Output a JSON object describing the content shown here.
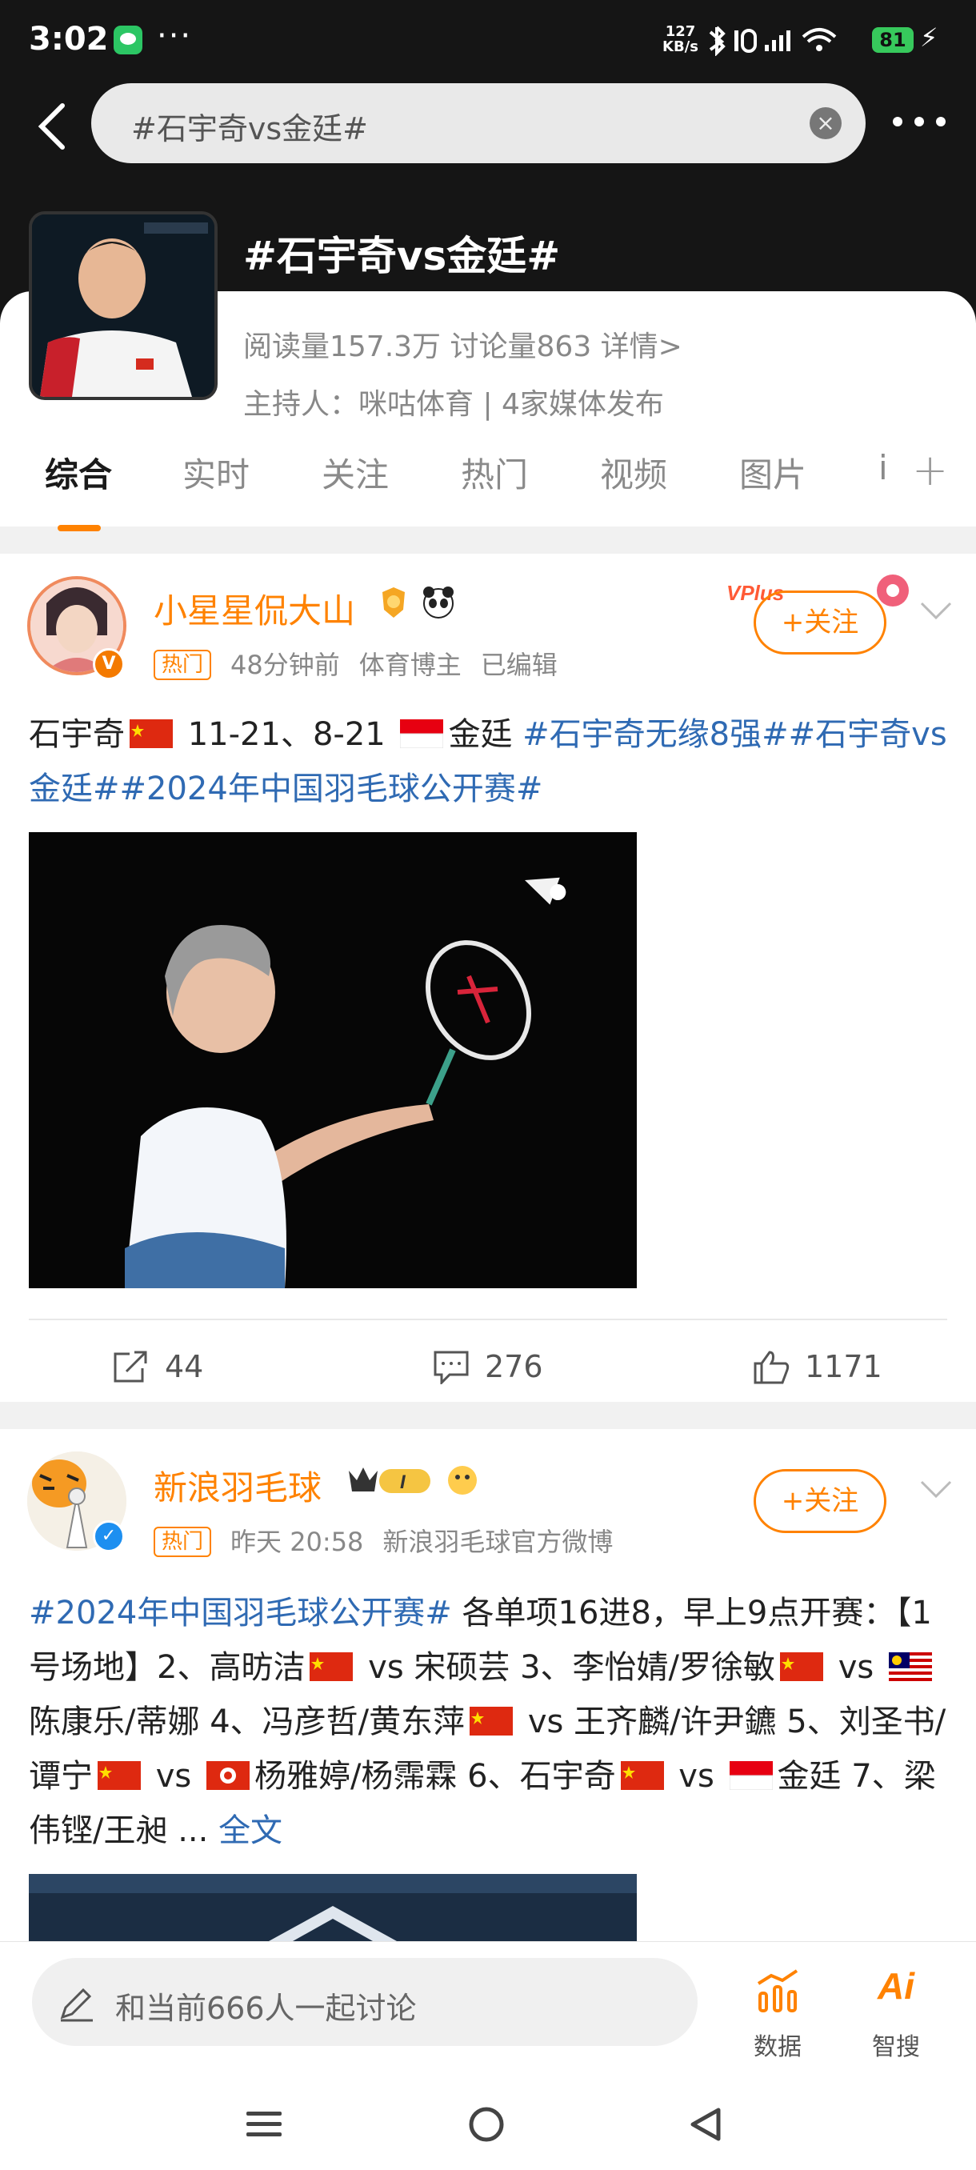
{
  "status_bar": {
    "time": "3:02",
    "speed_value": "127",
    "speed_unit": "KB/s",
    "battery": "81"
  },
  "nav": {
    "search_text": "#石宇奇vs金廷#",
    "back_icon": "chevron-left-icon",
    "more_icon": "more-dots-icon"
  },
  "topic": {
    "title": "#石宇奇vs金廷#",
    "stats": "阅读量157.3万  讨论量863  详情>",
    "host": "主持人：咪咕体育 | 4家媒体发布"
  },
  "tabs": [
    {
      "label": "综合",
      "active": true
    },
    {
      "label": "实时"
    },
    {
      "label": "关注"
    },
    {
      "label": "热门"
    },
    {
      "label": "视频"
    },
    {
      "label": "图片"
    },
    {
      "label": "i"
    }
  ],
  "posts": [
    {
      "username": "小星星侃大山",
      "hot_tag": "热门",
      "time": "48分钟前",
      "source": "体育博主",
      "edited": "已编辑",
      "follow_label": "+关注",
      "vplus_badge": "VPlus",
      "text_parts": {
        "p1": "石宇奇",
        "p2": " 11-21、8-21 ",
        "p3": "金廷   ",
        "tags": "#石宇奇无缘8强##石宇奇vs金廷##2024年中国羽毛球公开赛#"
      },
      "actions": {
        "share": "44",
        "comment": "276",
        "like": "1171"
      }
    },
    {
      "username": "新浪羽毛球",
      "level_badge": "I",
      "hot_tag": "热门",
      "time": "昨天 20:58",
      "source": "新浪羽毛球官方微博",
      "follow_label": "+关注",
      "text_parts": {
        "tag": "#2024年中国羽毛球公开赛#",
        "t1": " 各单项16进8，早上9点开赛：【1号场地】2、高昉洁",
        "t2": " vs 宋硕芸 3、李怡婧/罗徐敏",
        "t3": " vs ",
        "t4": "陈康乐/蒂娜 4、冯彦哲/黄东萍",
        "t5": " vs 王齐麟/许尹鑣 5、刘圣书/谭宁",
        "t6": " vs ",
        "t7": "杨雅婷/杨霈霖 6、石宇奇",
        "t8": " vs ",
        "t9": "金廷 7、梁伟铿/王昶 ... ",
        "more": "全文"
      }
    }
  ],
  "bottom_bar": {
    "discuss_placeholder": "和当前666人一起讨论",
    "data_label": "数据",
    "ai_label": "智搜",
    "ai_text": "Ai"
  },
  "colors": {
    "accent": "#ff8200",
    "link": "#2f6ab3",
    "header_bg": "#151515"
  }
}
